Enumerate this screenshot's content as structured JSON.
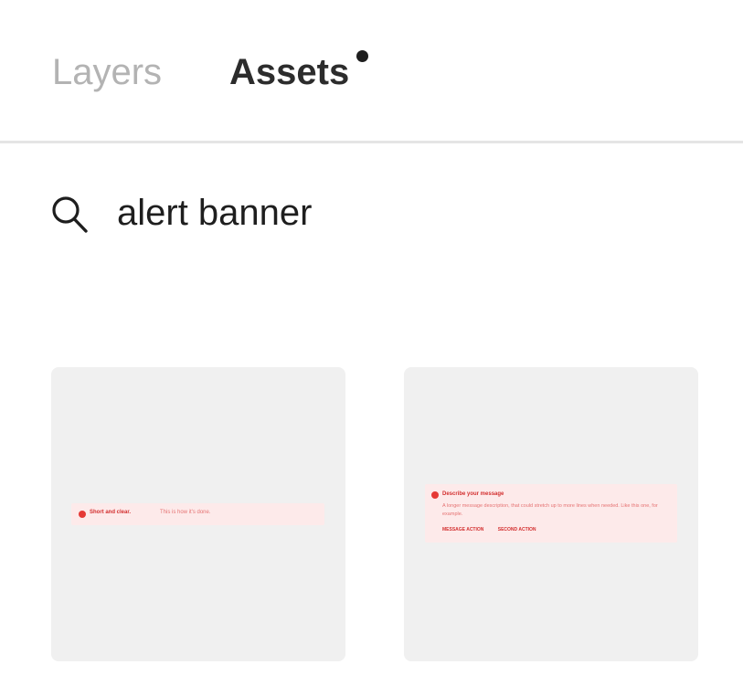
{
  "tabs": {
    "layers_label": "Layers",
    "assets_label": "Assets",
    "active": "Assets",
    "assets_has_update_dot": true
  },
  "search": {
    "value": "alert banner",
    "icon": "search-icon"
  },
  "results": [
    {
      "banner_title": "Short and clear.",
      "banner_description": "This is how it's done.",
      "icon": "error-circle-icon"
    },
    {
      "banner_title": "Describe your message",
      "banner_description": "A longer message description, that could stretch up to more lines when needed. Like this one, for example.",
      "primary_action": "MESSAGE ACTION",
      "secondary_action": "SECOND ACTION",
      "icon": "error-circle-icon"
    }
  ],
  "colors": {
    "active_tab": "#2c2c2c",
    "inactive_tab": "#b3b3b3",
    "card_bg": "#f0f0f0",
    "banner_bg": "#fdeaea",
    "banner_accent": "#e53935"
  }
}
